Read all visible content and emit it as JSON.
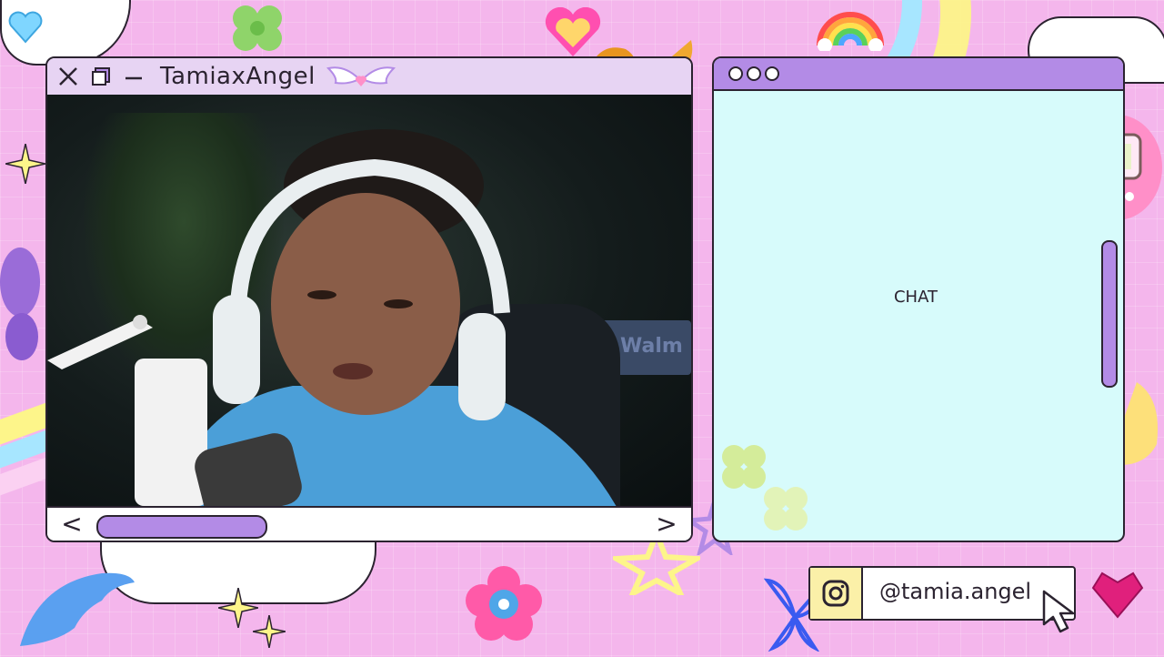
{
  "camera_window": {
    "title": "TamiaxAngel",
    "scroll_left_label": "<",
    "scroll_right_label": ">",
    "background_sign_text": "Walm"
  },
  "chat_window": {
    "label": "CHAT"
  },
  "social": {
    "platform_icon": "instagram-icon",
    "handle": "@tamia.angel"
  },
  "colors": {
    "background_pink": "#f4b6ec",
    "window_lavender": "#e7d4f3",
    "accent_purple": "#b38be6",
    "chat_cyan": "#d7fbfb",
    "ig_yellow": "#fbf0a8",
    "outline": "#2b2330"
  },
  "decorations": [
    "heart-icon",
    "clover-icon",
    "rainbow-icon",
    "butterfly-icon",
    "sparkle-icon",
    "tamagotchi-icon",
    "dolphin-icon",
    "flower-icon",
    "gem-heart-icon",
    "cursor-icon",
    "cloud-icon",
    "angel-wings-icon"
  ]
}
